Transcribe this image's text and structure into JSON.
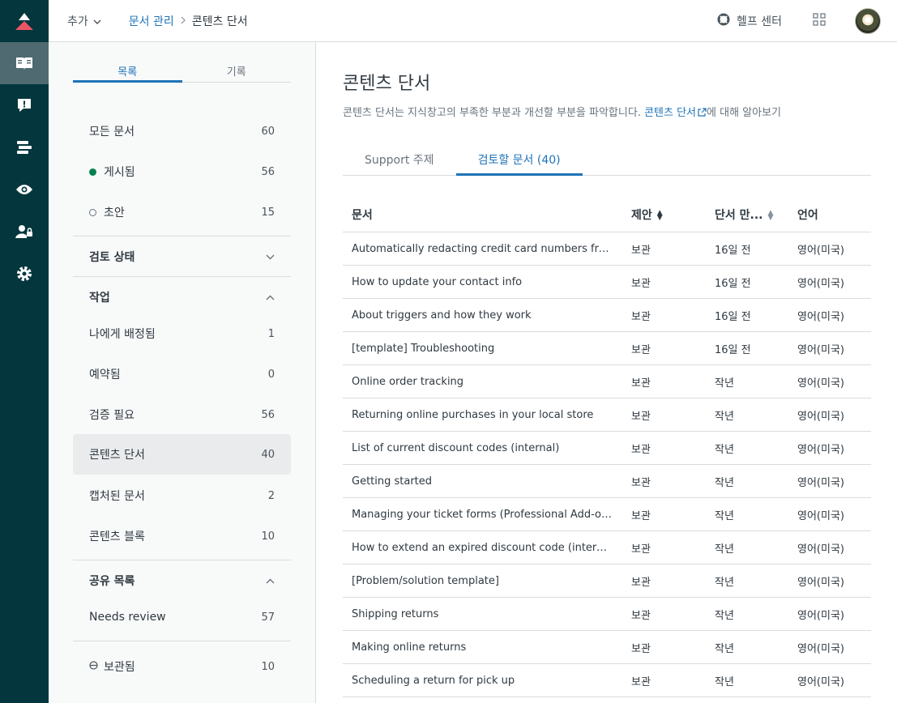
{
  "rail": {
    "icons": [
      "logo-icon",
      "knowledge-icon",
      "feedback-icon",
      "list-icon",
      "eye-icon",
      "user-lock-icon",
      "gear-icon"
    ]
  },
  "header": {
    "add_label": "추가",
    "breadcrumb_parent": "문서 관리",
    "breadcrumb_current": "콘텐츠 단서",
    "help_label": "헬프 센터"
  },
  "sidebar": {
    "tabs": [
      "목록",
      "기록"
    ],
    "items": {
      "all": {
        "label": "모든 문서",
        "count": "60"
      },
      "published": {
        "label": "게시됨",
        "count": "56"
      },
      "draft": {
        "label": "초안",
        "count": "15"
      }
    },
    "review_status_label": "검토 상태",
    "work_label": "작업",
    "work_items": [
      {
        "label": "나에게 배정됨",
        "count": "1"
      },
      {
        "label": "예약됨",
        "count": "0"
      },
      {
        "label": "검증 필요",
        "count": "56"
      },
      {
        "label": "콘텐츠 단서",
        "count": "40"
      },
      {
        "label": "캡처된 문서",
        "count": "2"
      },
      {
        "label": "콘텐츠 블록",
        "count": "10"
      }
    ],
    "shared_label": "공유 목록",
    "shared_items": [
      {
        "label": "Needs review",
        "count": "57"
      }
    ],
    "archived": {
      "label": "보관됨",
      "count": "10"
    }
  },
  "main": {
    "title": "콘텐츠 단서",
    "desc_before": "콘텐츠 단서는 지식창고의 부족한 부분과 개선할 부분을 파악합니다. ",
    "desc_link": "콘텐츠 단서",
    "desc_after": "에 대해 알아보기",
    "tabs": [
      "Support 주제",
      "검토할 문서 (40)"
    ],
    "columns": [
      "문서",
      "제안",
      "단서 만...",
      "언어"
    ],
    "rows": [
      {
        "doc": "Automatically redacting credit card numbers from...",
        "suggestion": "보관",
        "date": "16일 전",
        "lang": "영어(미국)"
      },
      {
        "doc": "How to update your contact info",
        "suggestion": "보관",
        "date": "16일 전",
        "lang": "영어(미국)"
      },
      {
        "doc": "About triggers and how they work",
        "suggestion": "보관",
        "date": "16일 전",
        "lang": "영어(미국)"
      },
      {
        "doc": "[template] Troubleshooting",
        "suggestion": "보관",
        "date": "16일 전",
        "lang": "영어(미국)"
      },
      {
        "doc": "Online order tracking",
        "suggestion": "보관",
        "date": "작년",
        "lang": "영어(미국)"
      },
      {
        "doc": "Returning online purchases in your local store",
        "suggestion": "보관",
        "date": "작년",
        "lang": "영어(미국)"
      },
      {
        "doc": "List of current discount codes (internal)",
        "suggestion": "보관",
        "date": "작년",
        "lang": "영어(미국)"
      },
      {
        "doc": "Getting started",
        "suggestion": "보관",
        "date": "작년",
        "lang": "영어(미국)"
      },
      {
        "doc": "Managing your ticket forms (Professional Add-on ...",
        "suggestion": "보관",
        "date": "작년",
        "lang": "영어(미국)"
      },
      {
        "doc": "How to extend an expired discount code (internal)",
        "suggestion": "보관",
        "date": "작년",
        "lang": "영어(미국)"
      },
      {
        "doc": "[Problem/solution template]",
        "suggestion": "보관",
        "date": "작년",
        "lang": "영어(미국)"
      },
      {
        "doc": "Shipping returns",
        "suggestion": "보관",
        "date": "작년",
        "lang": "영어(미국)"
      },
      {
        "doc": "Making online returns",
        "suggestion": "보관",
        "date": "작년",
        "lang": "영어(미국)"
      },
      {
        "doc": "Scheduling a return for pick up",
        "suggestion": "보관",
        "date": "작년",
        "lang": "영어(미국)"
      }
    ]
  },
  "colors": {
    "rail": "#03363d",
    "accent": "#1f73b7",
    "published": "#038153",
    "logo": "#ed5565"
  }
}
